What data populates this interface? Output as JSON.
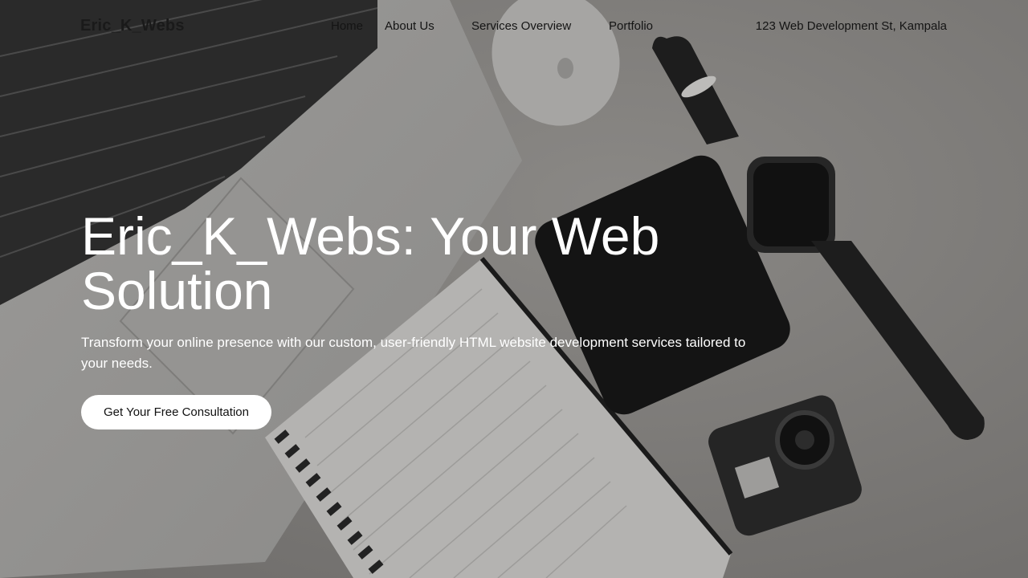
{
  "header": {
    "logo": "Eric_K_Webs",
    "nav": [
      "Home",
      "About Us",
      "Services Overview",
      "Portfolio"
    ],
    "address": "123 Web Development St, Kampala"
  },
  "hero": {
    "title": "Eric_K_Webs: Your Web Solution",
    "subtitle": "Transform your online presence with our custom, user-friendly HTML website development services tailored to your needs.",
    "cta_label": "Get Your Free Consultation"
  },
  "colors": {
    "background": "#7e7c79",
    "text_light": "#ffffff",
    "text_dark": "#141414",
    "button_bg": "#ffffff"
  }
}
